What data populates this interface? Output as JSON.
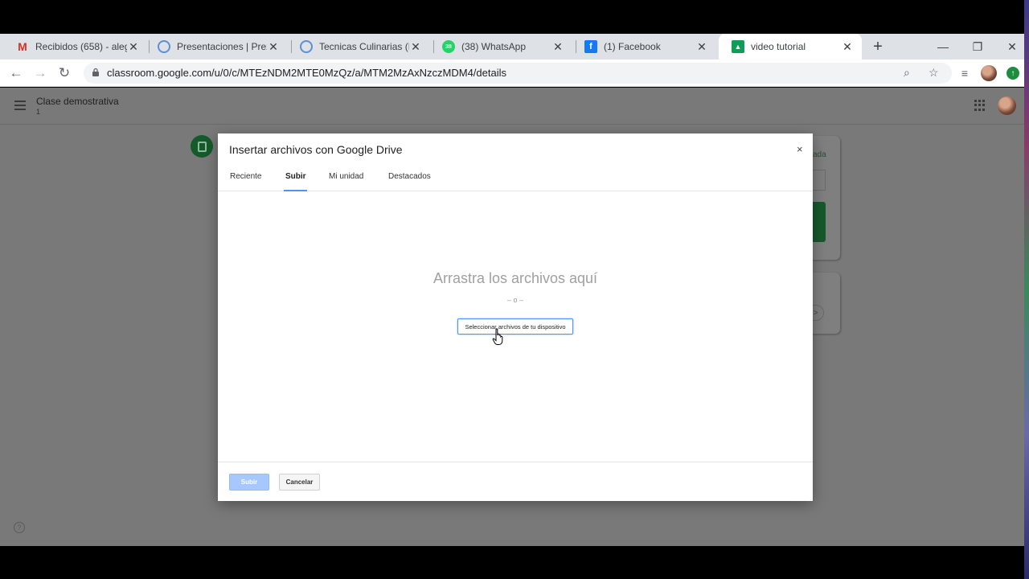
{
  "browser": {
    "tabs": [
      {
        "title": "Recibidos (658) - alegd",
        "favicon": "gmail-icon",
        "active": false
      },
      {
        "title": "Presentaciones | Prezi",
        "favicon": "prezi-icon",
        "active": false
      },
      {
        "title": "Tecnicas Culinarias (Mo",
        "favicon": "prezi-icon",
        "active": false
      },
      {
        "title": "(38) WhatsApp",
        "favicon": "whatsapp-icon",
        "active": false
      },
      {
        "title": "(1) Facebook",
        "favicon": "facebook-icon",
        "active": false
      },
      {
        "title": "video tutorial",
        "favicon": "classroom-icon",
        "active": true
      }
    ],
    "url": "classroom.google.com/u/0/c/MTEzNDM2MTE0MzQz/a/MTM2MzAxNzczMDM4/details"
  },
  "classroom": {
    "class_title": "Clase demostrativa",
    "class_subtitle": "1",
    "right_card_text": "ada"
  },
  "dialog": {
    "title": "Insertar archivos con Google Drive",
    "close_label": "×",
    "tabs": [
      "Reciente",
      "Subir",
      "Mi unidad",
      "Destacados"
    ],
    "active_tab": "Subir",
    "drop_text": "Arrastra los archivos aquí",
    "or_text": "– o –",
    "select_button": "Seleccionar archivos de tu dispositivo",
    "upload_button": "Subir",
    "cancel_button": "Cancelar"
  },
  "colors": {
    "accent_blue": "#4d90fe",
    "classroom_green": "#155a2b",
    "overlay": "#797979"
  }
}
